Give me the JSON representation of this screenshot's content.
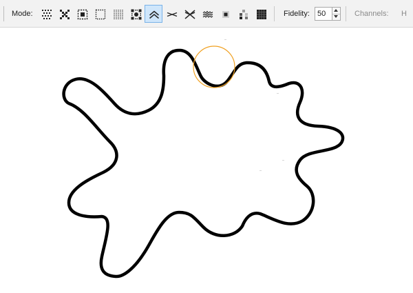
{
  "toolbar": {
    "mode_label": "Mode:",
    "fidelity_label": "Fidelity:",
    "fidelity_value": "50",
    "channels_label": "Channels:",
    "channels_overflow": "H",
    "modes": [
      {
        "icon": "dither-grid-icon",
        "active": false
      },
      {
        "icon": "dither-cross-icon",
        "active": false
      },
      {
        "icon": "dither-frame-icon",
        "active": false
      },
      {
        "icon": "dotted-square-icon",
        "active": false
      },
      {
        "icon": "vertical-stripes-icon",
        "active": false
      },
      {
        "icon": "corner-dots-icon",
        "active": false
      },
      {
        "icon": "double-chevron-up-icon",
        "active": true
      },
      {
        "icon": "bowtie-icon",
        "active": false
      },
      {
        "icon": "cross-lines-icon",
        "active": false
      },
      {
        "icon": "zigzag-lines-icon",
        "active": false
      },
      {
        "icon": "center-dot-icon",
        "active": false
      },
      {
        "icon": "pixel-steps-icon",
        "active": false
      },
      {
        "icon": "filled-grid-icon",
        "active": false
      }
    ]
  },
  "canvas": {
    "stroke_color": "#000000",
    "brush_color": "#f0a020"
  }
}
